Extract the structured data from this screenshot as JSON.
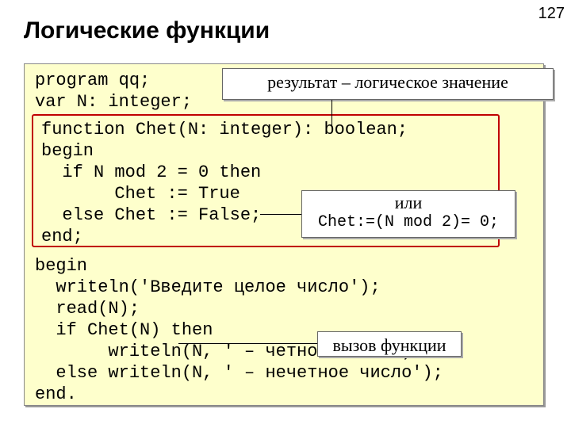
{
  "page_number": "127",
  "title": "Логические функции",
  "code_top": "program qq;\nvar N: integer;",
  "func_code": "function Chet(N: integer): boolean;\nbegin\n  if N mod 2 = 0 then\n       Chet := True\n  else Chet := False;\nend;",
  "code_bottom": "begin\n  writeln('Введите целое число');\n  read(N);\n  if Chet(N) then\n       writeln(N, ' – четное число')\n  else writeln(N, ' – нечетное число');\nend.",
  "callout1": "результат – логическое значение",
  "callout2_line1": "или",
  "callout2_line2": "Chet:=(N mod 2)= 0;",
  "callout3": "вызов функции"
}
